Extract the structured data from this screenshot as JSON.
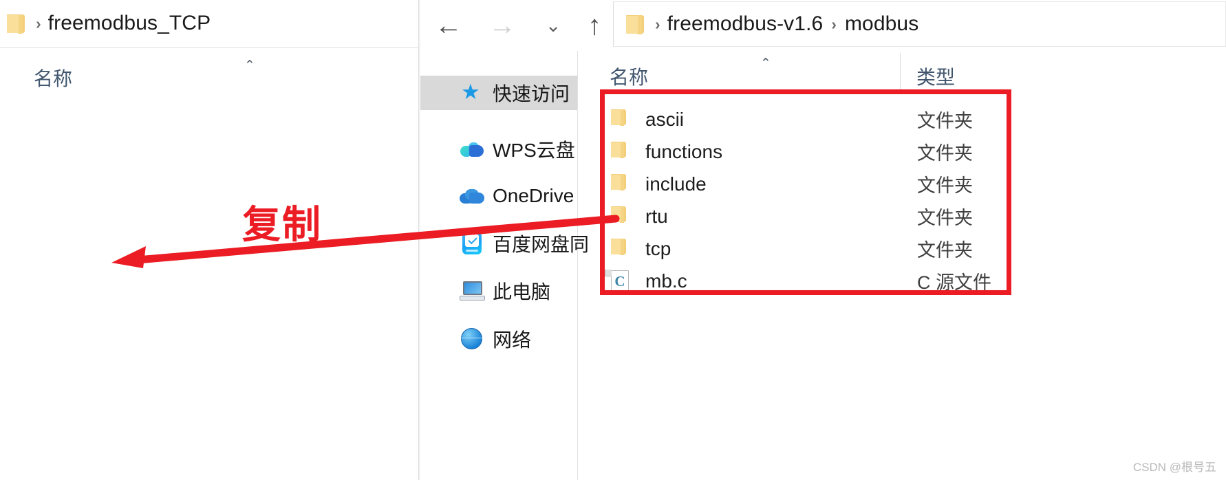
{
  "left_panel": {
    "breadcrumb": {
      "folder_icon": "folder-icon",
      "separator": "›",
      "path": "freemodbus_TCP"
    },
    "column_headers": {
      "name": "名称",
      "sort_caret": "⌃"
    },
    "empty_body": ""
  },
  "right_window": {
    "toolbar": {
      "back_label": "←",
      "forward_label": "→",
      "recent_label": "⌄",
      "up_label": "↑",
      "back_name": "back-button",
      "forward_name": "forward-button",
      "recent_name": "recent-locations-button",
      "up_name": "up-button"
    },
    "address_bar": {
      "folder_icon": "folder-icon",
      "separator": "›",
      "crumbs": [
        "freemodbus-v1.6",
        "modbus"
      ]
    },
    "sidebar": {
      "items": [
        {
          "label": "快速访问",
          "icon": "star-icon",
          "selected": true
        },
        {
          "label": "WPS云盘",
          "icon": "wps-cloud-icon",
          "selected": false
        },
        {
          "label": "OneDrive",
          "icon": "onedrive-icon",
          "selected": false
        },
        {
          "label": "百度网盘同",
          "icon": "baidu-netdisk-icon",
          "selected": false
        },
        {
          "label": "此电脑",
          "icon": "this-pc-icon",
          "selected": false
        },
        {
          "label": "网络",
          "icon": "network-icon",
          "selected": false
        }
      ]
    },
    "column_headers": {
      "name": "名称",
      "type": "类型",
      "sort_caret": "⌃"
    },
    "files": [
      {
        "name": "ascii",
        "type": "文件夹",
        "icon": "folder-icon"
      },
      {
        "name": "functions",
        "type": "文件夹",
        "icon": "folder-icon"
      },
      {
        "name": "include",
        "type": "文件夹",
        "icon": "folder-icon"
      },
      {
        "name": "rtu",
        "type": "文件夹",
        "icon": "folder-icon"
      },
      {
        "name": "tcp",
        "type": "文件夹",
        "icon": "folder-icon"
      },
      {
        "name": "mb.c",
        "type": "C 源文件",
        "icon": "c-source-file-icon",
        "icon_glyph": "C"
      }
    ]
  },
  "annotation": {
    "label": "复制",
    "color": "#ec1c24",
    "highlight_name": "selection-highlight-rectangle",
    "arrow_name": "copy-direction-arrow"
  },
  "watermark": {
    "text": "CSDN @根号五"
  }
}
